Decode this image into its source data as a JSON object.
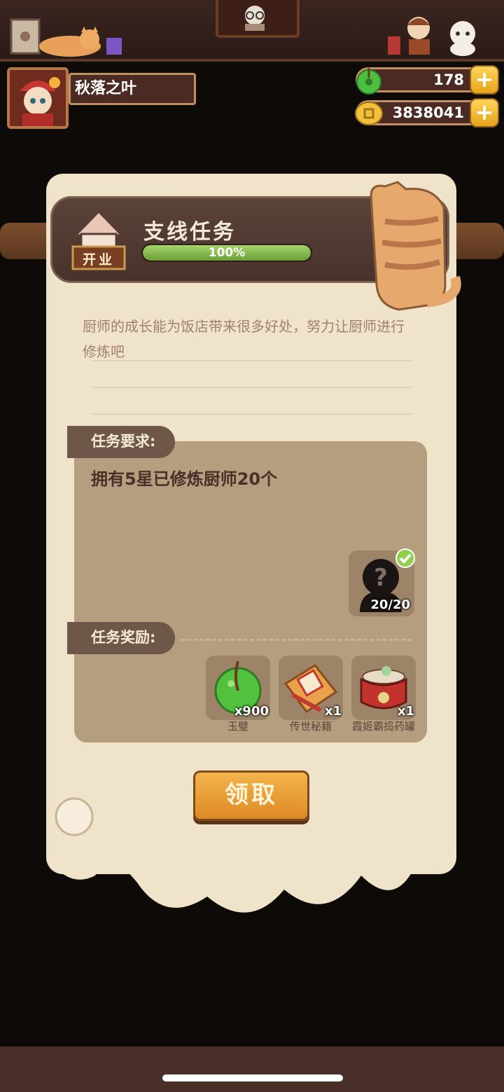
{
  "player": {
    "name": "秋落之叶"
  },
  "currencies": {
    "jade": {
      "value": "178",
      "icon": "green-jade-icon"
    },
    "coins": {
      "value": "3838041",
      "icon": "gold-coin-icon"
    }
  },
  "quest": {
    "type_badge": "开业",
    "title": "支线任务",
    "progress_text": "100%",
    "progress": 1.0,
    "description": "厨师的成长能为饭店带来很多好处，努力让厨师进行修炼吧"
  },
  "requirement": {
    "tab_label": "任务要求:",
    "text": "拥有5星已修炼厨师20个",
    "count": "20/20",
    "completed": true
  },
  "rewards": {
    "tab_label": "任务奖励:",
    "items": [
      {
        "name": "玉璧",
        "count": "x900",
        "icon": "green-jade-icon"
      },
      {
        "name": "传世秘籍",
        "count": "x1",
        "icon": "secret-book-icon"
      },
      {
        "name": "霞姬霸捣药罐",
        "count": "x1",
        "icon": "medicine-jar-icon"
      }
    ]
  },
  "claim_label": "领取",
  "colors": {
    "accent": "#e5a51a",
    "progress": "#8fc152",
    "panel": "#b59d80"
  }
}
